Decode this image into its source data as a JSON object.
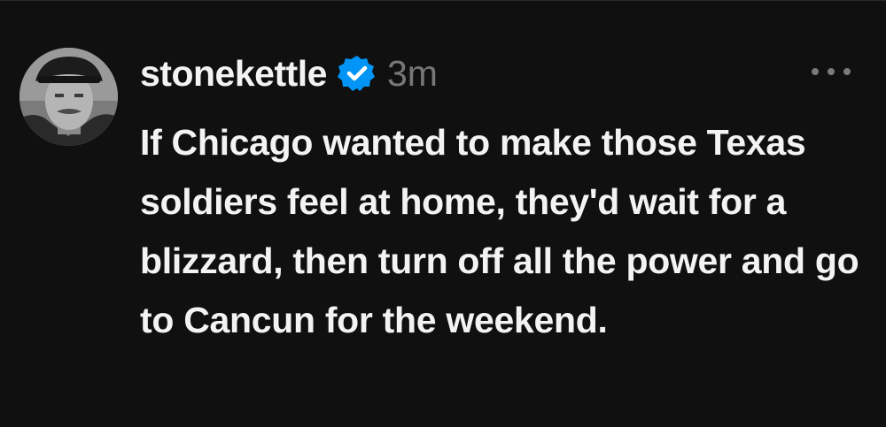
{
  "post": {
    "username": "stonekettle",
    "timestamp": "3m",
    "text": "If Chicago wanted to make those Texas soldiers feel at home, they'd wait for a blizzard, then turn off all the power and go to Cancun for the weekend.",
    "verified": true,
    "verified_color": "#0095f6",
    "avatar_icon": "profile-photo",
    "more_icon": "more-options-icon"
  }
}
